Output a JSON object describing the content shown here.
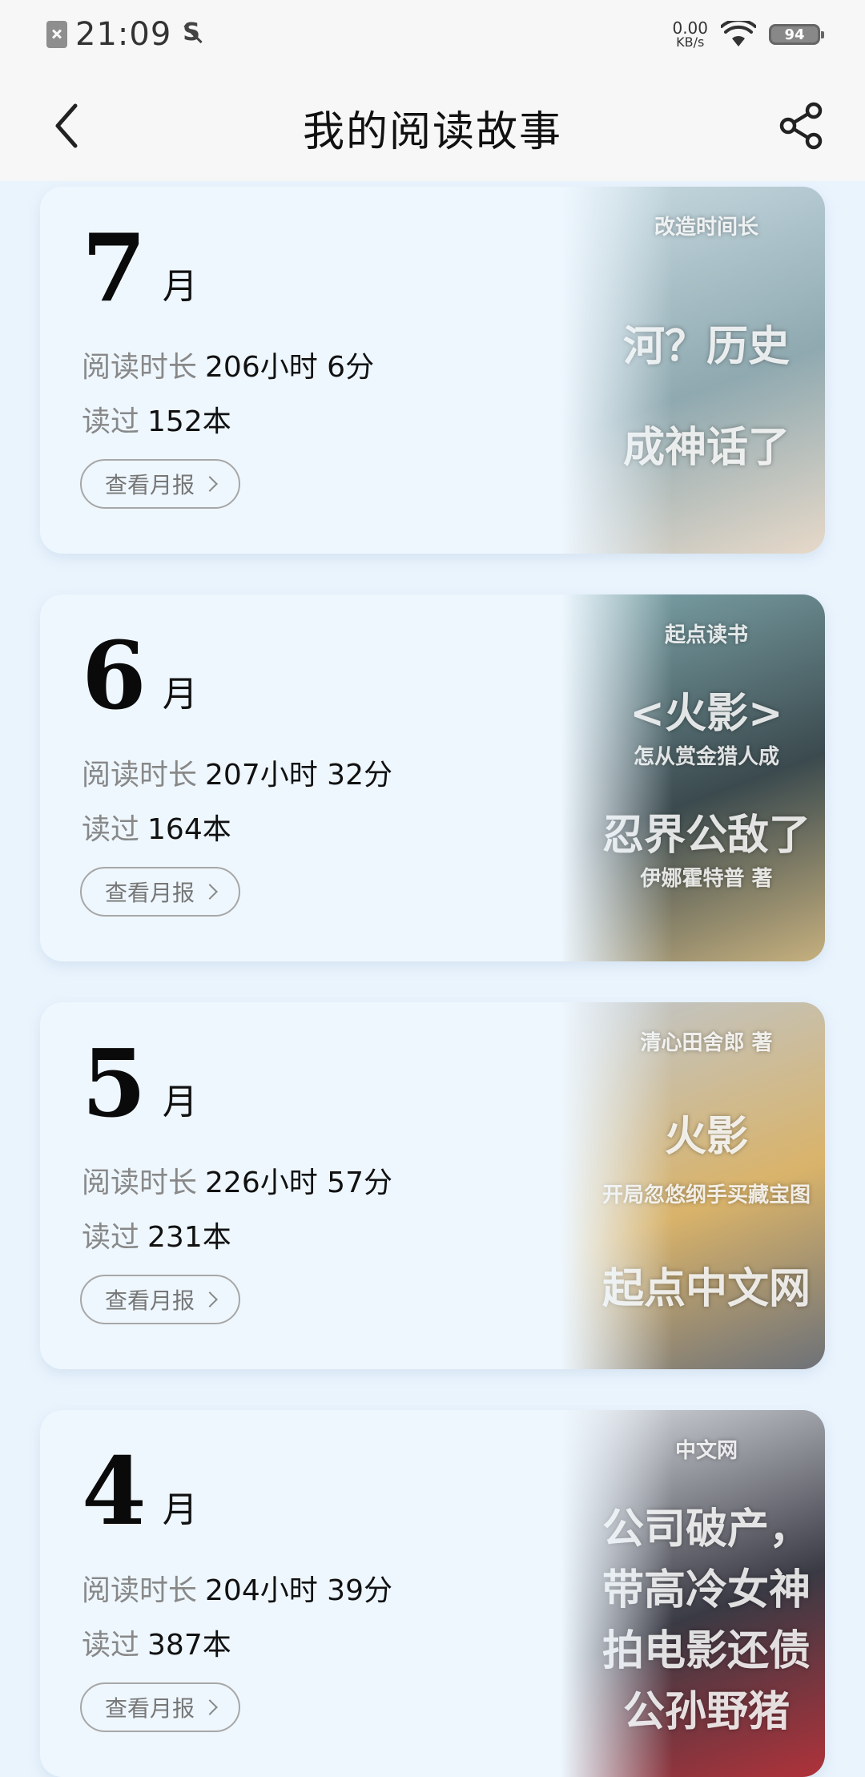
{
  "status_bar": {
    "time": "21:09",
    "net_speed_value": "0.00",
    "net_speed_unit": "KB/s",
    "battery": "94",
    "icons": [
      "sim-off-icon",
      "no-sim-glyph-icon",
      "wifi-icon",
      "battery-icon"
    ]
  },
  "nav": {
    "title": "我的阅读故事",
    "back_icon": "chevron-left-icon",
    "share_icon": "share-icon"
  },
  "labels": {
    "duration": "阅读时长",
    "read": "读过",
    "month_unit": "月",
    "report_button": "查看月报"
  },
  "months": [
    {
      "month": "7",
      "duration": "206小时 6分",
      "books": "152本",
      "cover_texts": [
        "改造时间长",
        "河？历史",
        "成神话了"
      ],
      "cover_colors": [
        "#c9dbe3",
        "#8fa9b0",
        "#e7d9c9"
      ]
    },
    {
      "month": "6",
      "duration": "207小时 32分",
      "books": "164本",
      "cover_texts": [
        "起点读书",
        "<火影>",
        "怎从赏金猎人成",
        "忍界公敌了",
        "伊娜霍特普 著"
      ],
      "cover_colors": [
        "#7fa8ad",
        "#3b4a4e",
        "#c6b07e"
      ]
    },
    {
      "month": "5",
      "duration": "226小时 57分",
      "books": "231本",
      "cover_texts": [
        "清心田舍郎 著",
        "火影",
        "开局忽悠纲手买藏宝图",
        "起点中文网"
      ],
      "cover_colors": [
        "#bfc6cc",
        "#d9b36a",
        "#6d7178"
      ]
    },
    {
      "month": "4",
      "duration": "204小时 39分",
      "books": "387本",
      "cover_texts": [
        "中文网",
        "公司破产，",
        "带高冷女神",
        "拍电影还债",
        "公孙野猪"
      ],
      "cover_colors": [
        "#d9dde2",
        "#3a3a44",
        "#b0323a"
      ]
    }
  ]
}
